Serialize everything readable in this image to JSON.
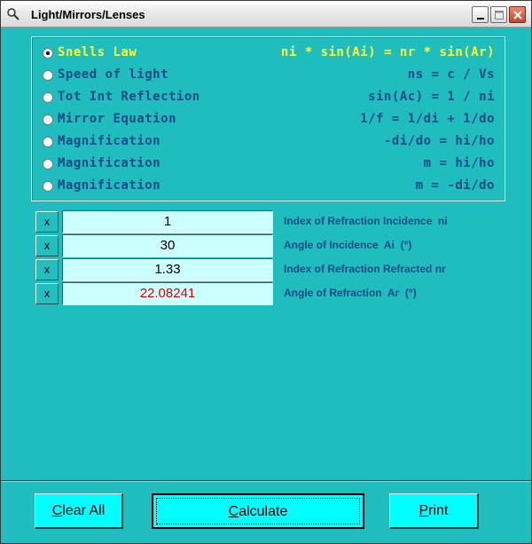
{
  "window": {
    "title": "Light/Mirrors/Lenses",
    "title_icon": "magnifier-icon",
    "controls": [
      "minimize-icon",
      "maximize-icon",
      "close-icon"
    ]
  },
  "options": [
    {
      "label": "Snells Law",
      "formula": "ni * sin(Ai) = nr * sin(Ar)",
      "selected": true
    },
    {
      "label": "Speed of light",
      "formula": "ns = c / Vs",
      "selected": false
    },
    {
      "label": "Tot Int Reflection",
      "formula": "sin(Ac) = 1 / ni",
      "selected": false
    },
    {
      "label": "Mirror Equation",
      "formula": "1/f = 1/di + 1/do",
      "selected": false
    },
    {
      "label": "Magnification",
      "formula": "-di/do = hi/ho",
      "selected": false
    },
    {
      "label": "Magnification",
      "formula": "m = hi/ho",
      "selected": false
    },
    {
      "label": "Magnification",
      "formula": "m = -di/do",
      "selected": false
    }
  ],
  "inputs": [
    {
      "clear": "x",
      "value": "1",
      "description": "Index of Refraction Incidence  ni"
    },
    {
      "clear": "x",
      "value": "30",
      "description": "Angle of Incidence  Ai  (°)"
    },
    {
      "clear": "x",
      "value": "1.33",
      "description": "Index of Refraction Refracted nr"
    },
    {
      "clear": "x",
      "value": "22.08241",
      "description": "Angle of Refraction  Ar  (°)"
    }
  ],
  "buttons": {
    "clear_all": {
      "mnemonic": "C",
      "rest": "lear All"
    },
    "calculate": {
      "mnemonic": "C",
      "rest": "alculate"
    },
    "print": {
      "mnemonic": "P",
      "rest": "rint"
    }
  },
  "colors": {
    "background": "#1fbdbd",
    "label_text": "#144a8a",
    "selected_option": "#ffff33",
    "field_bg": "#ccffff",
    "result_text": "#e00000",
    "button_bg": "#00ffff"
  }
}
